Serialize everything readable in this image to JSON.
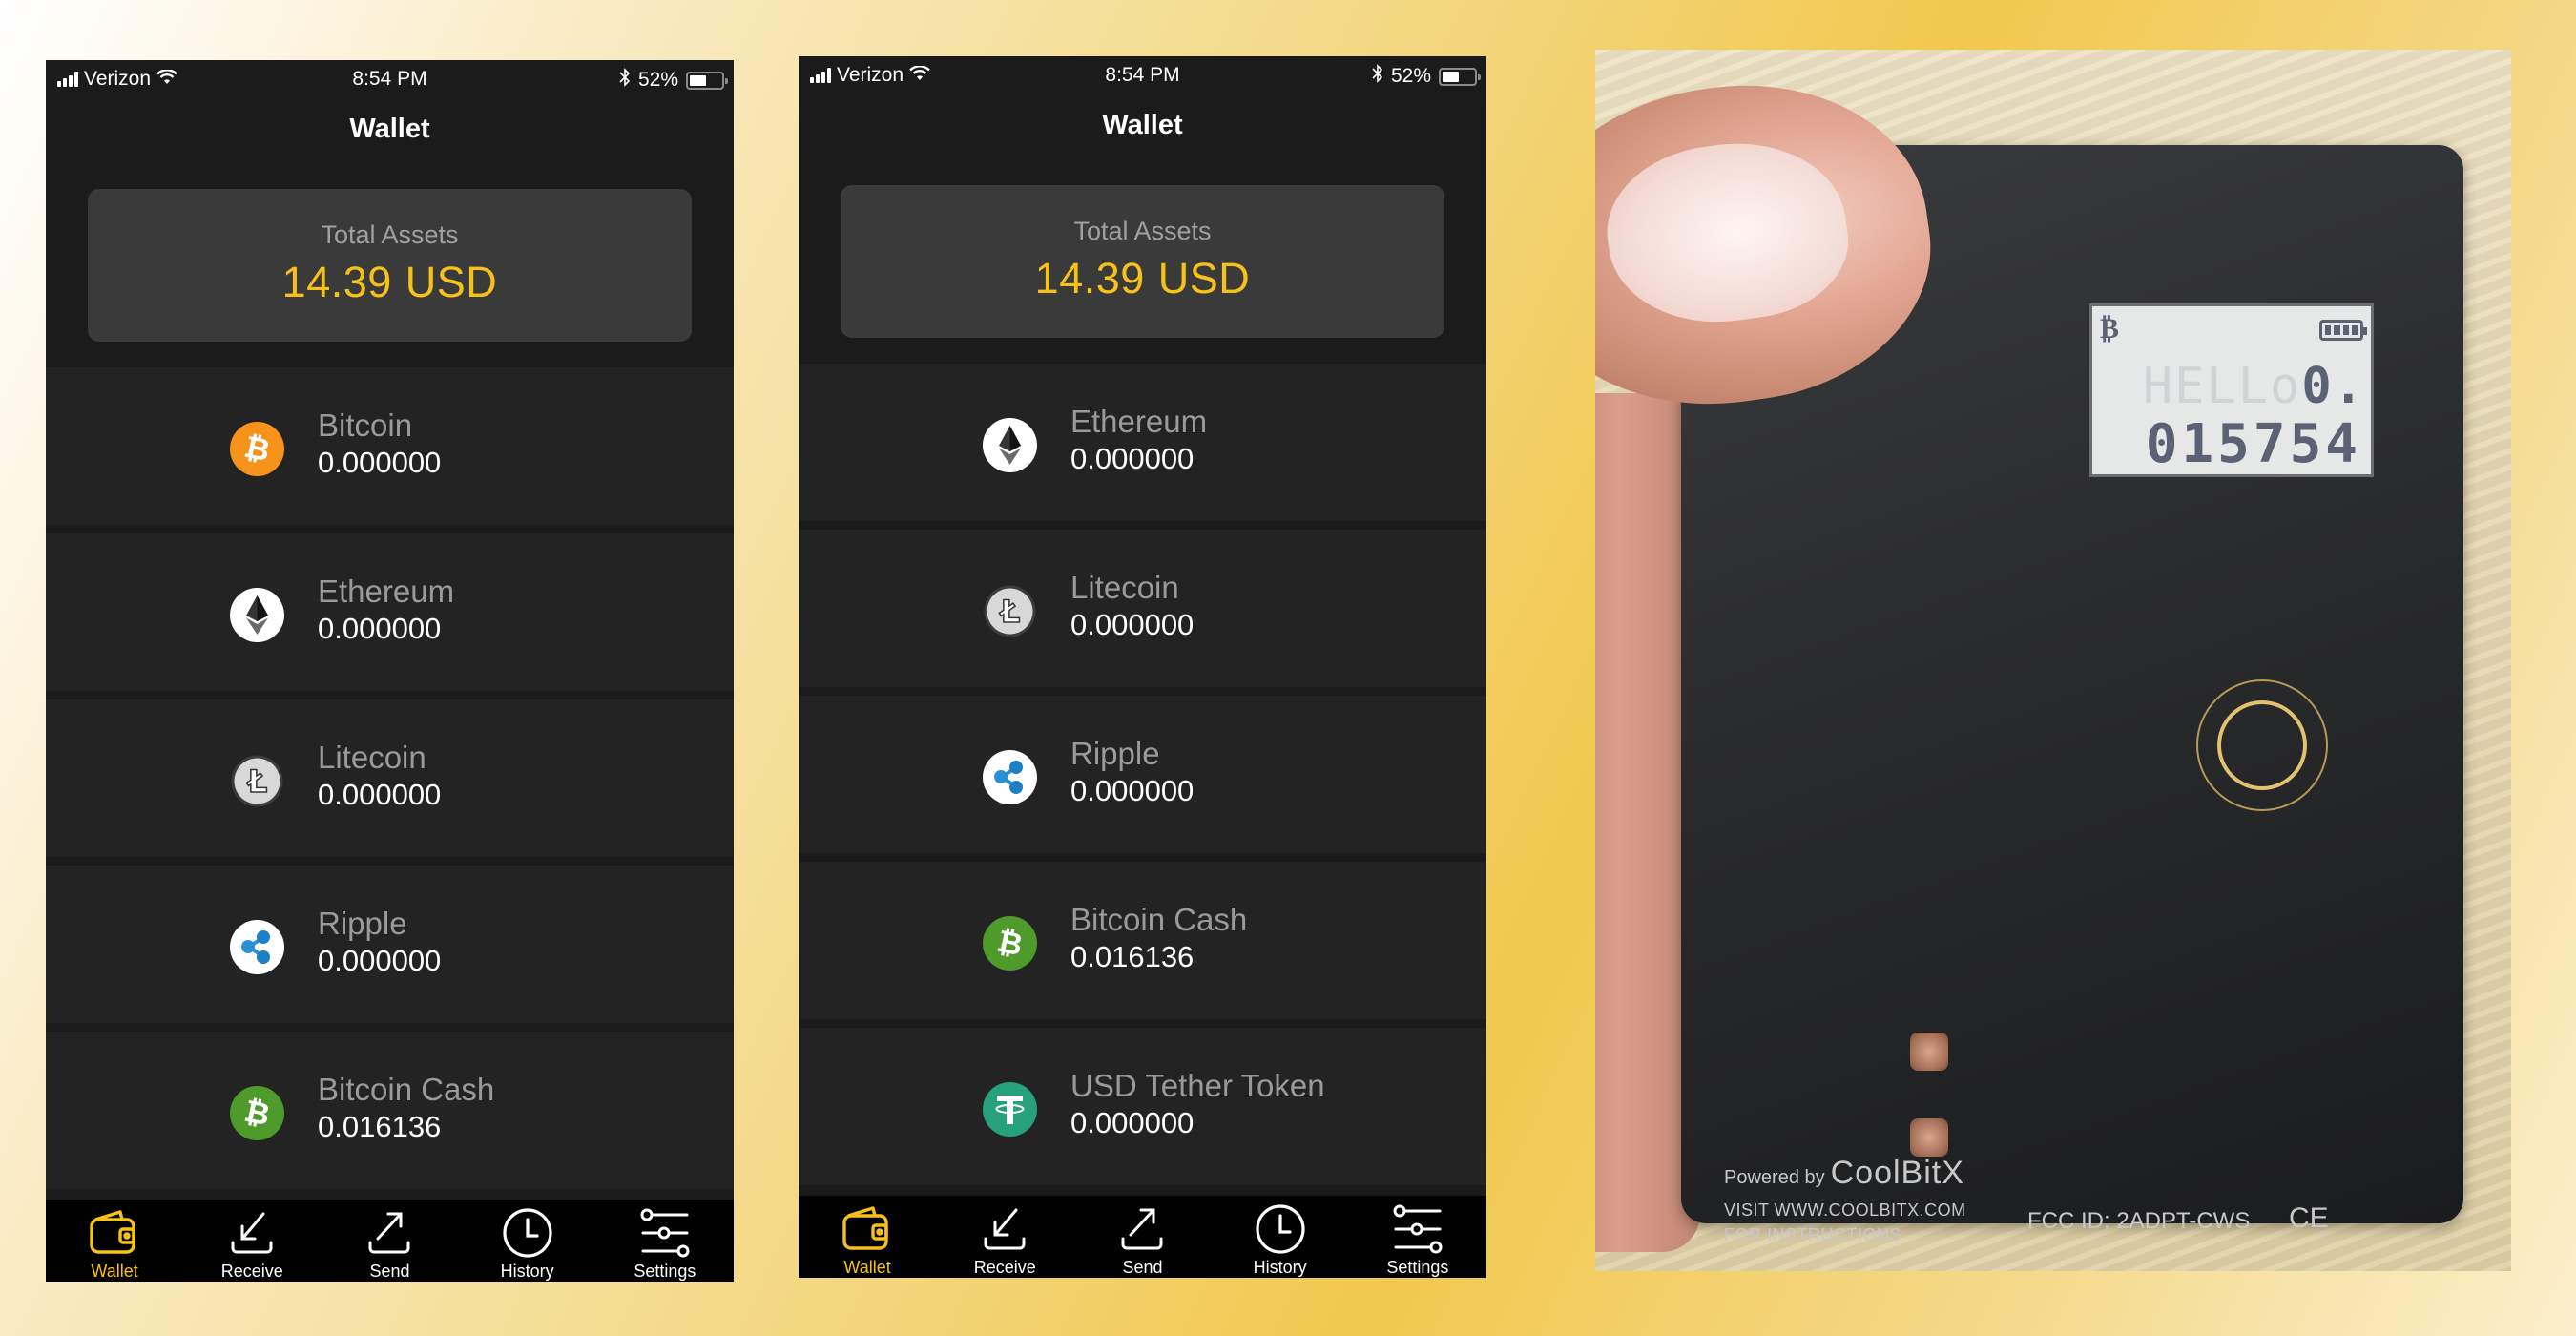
{
  "theme": {
    "accent": "#f6c21a",
    "phone_bg": "#1b1b1b",
    "row_bg": "#232323",
    "tabbar_bg": "#000000"
  },
  "phones": [
    {
      "status_bar": {
        "carrier": "Verizon",
        "time": "8:54 PM",
        "battery_percent": "52%",
        "battery_level": 0.52
      },
      "title": "Wallet",
      "total_assets": {
        "label": "Total Assets",
        "amount": "14.39",
        "currency": "USD"
      },
      "coins": [
        {
          "name": "Bitcoin",
          "balance": "0.000000",
          "icon": "bitcoin-icon",
          "color": "#f7931a"
        },
        {
          "name": "Ethereum",
          "balance": "0.000000",
          "icon": "ethereum-icon",
          "color": "#ffffff"
        },
        {
          "name": "Litecoin",
          "balance": "0.000000",
          "icon": "litecoin-icon",
          "color": "#d8d8d8"
        },
        {
          "name": "Ripple",
          "balance": "0.000000",
          "icon": "ripple-icon",
          "color": "#ffffff"
        },
        {
          "name": "Bitcoin Cash",
          "balance": "0.016136",
          "icon": "bitcoin-cash-icon",
          "color": "#4e9a2a"
        }
      ],
      "tabs": [
        {
          "label": "Wallet",
          "icon": "wallet-icon",
          "active": true
        },
        {
          "label": "Receive",
          "icon": "receive-icon",
          "active": false
        },
        {
          "label": "Send",
          "icon": "send-icon",
          "active": false
        },
        {
          "label": "History",
          "icon": "clock-icon",
          "active": false
        },
        {
          "label": "Settings",
          "icon": "sliders-icon",
          "active": false
        }
      ]
    },
    {
      "status_bar": {
        "carrier": "Verizon",
        "time": "8:54 PM",
        "battery_percent": "52%",
        "battery_level": 0.52
      },
      "title": "Wallet",
      "total_assets": {
        "label": "Total Assets",
        "amount": "14.39",
        "currency": "USD"
      },
      "coins": [
        {
          "name": "Ethereum",
          "balance": "0.000000",
          "icon": "ethereum-icon",
          "color": "#ffffff"
        },
        {
          "name": "Litecoin",
          "balance": "0.000000",
          "icon": "litecoin-icon",
          "color": "#d8d8d8"
        },
        {
          "name": "Ripple",
          "balance": "0.000000",
          "icon": "ripple-icon",
          "color": "#ffffff"
        },
        {
          "name": "Bitcoin Cash",
          "balance": "0.016136",
          "icon": "bitcoin-cash-icon",
          "color": "#4e9a2a"
        },
        {
          "name": "USD Tether Token",
          "balance": "0.000000",
          "icon": "tether-icon",
          "color": "#26a17b"
        }
      ],
      "tabs": [
        {
          "label": "Wallet",
          "icon": "wallet-icon",
          "active": true
        },
        {
          "label": "Receive",
          "icon": "receive-icon",
          "active": false
        },
        {
          "label": "Send",
          "icon": "send-icon",
          "active": false
        },
        {
          "label": "History",
          "icon": "clock-icon",
          "active": false
        },
        {
          "label": "Settings",
          "icon": "sliders-icon",
          "active": false
        }
      ]
    }
  ],
  "device_photo": {
    "lcd": {
      "coin_symbol": "₿",
      "ghost_text": "HELLo",
      "line1": "0.",
      "line2": "015754"
    },
    "powered_by": "Powered by",
    "brand": "CoolBitX",
    "visit_line1": "VISIT WWW.COOLBITX.COM",
    "visit_line2": "FOR INSTRUCTIONS",
    "fcc_id": "FCC ID: 2ADPT-CWS",
    "ce_mark": "CE"
  }
}
